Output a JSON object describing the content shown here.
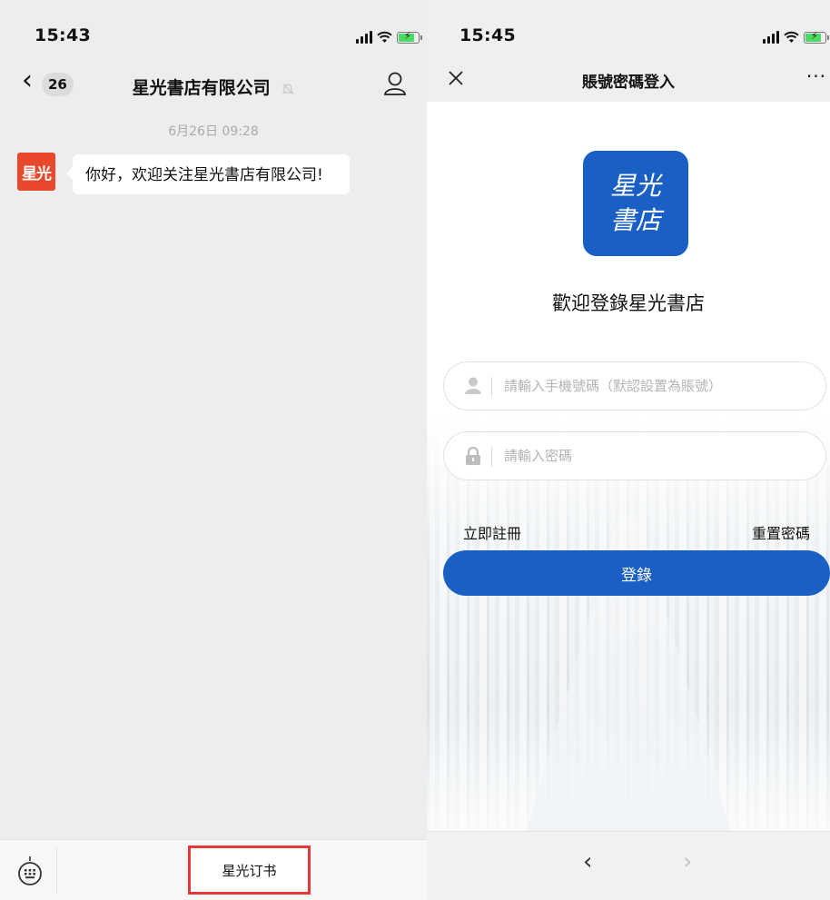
{
  "left": {
    "status": {
      "time": "15:43"
    },
    "nav": {
      "back_count": "26",
      "title": "星光書店有限公司"
    },
    "chat": {
      "timestamp": "6月26日 09:28",
      "avatar_text": "星光",
      "message": "你好，欢迎关注星光書店有限公司!"
    },
    "bottom": {
      "menu_label": "星光订书"
    }
  },
  "right": {
    "status": {
      "time": "15:45"
    },
    "nav": {
      "title": "賬號密碼登入",
      "more": "···"
    },
    "logo": {
      "line1": "星光",
      "line2": "書店"
    },
    "welcome": "歡迎登錄星光書店",
    "form": {
      "phone_placeholder": "請輸入手機號碼（默認設置為賬號）",
      "password_placeholder": "請輸入密碼",
      "register_label": "立即註冊",
      "reset_label": "重置密碼",
      "login_label": "登錄"
    },
    "browser": {
      "back": "‹",
      "forward": "›"
    }
  },
  "colors": {
    "brand_blue": "#1a5fc4",
    "avatar_red": "#e8482c",
    "highlight_red": "#e53935",
    "chat_bg": "#ededed"
  },
  "icons": [
    "signal-icon",
    "wifi-icon",
    "battery-icon",
    "mute-bell-icon",
    "person-icon",
    "keyboard-icon",
    "close-icon",
    "user-icon",
    "lock-icon"
  ]
}
